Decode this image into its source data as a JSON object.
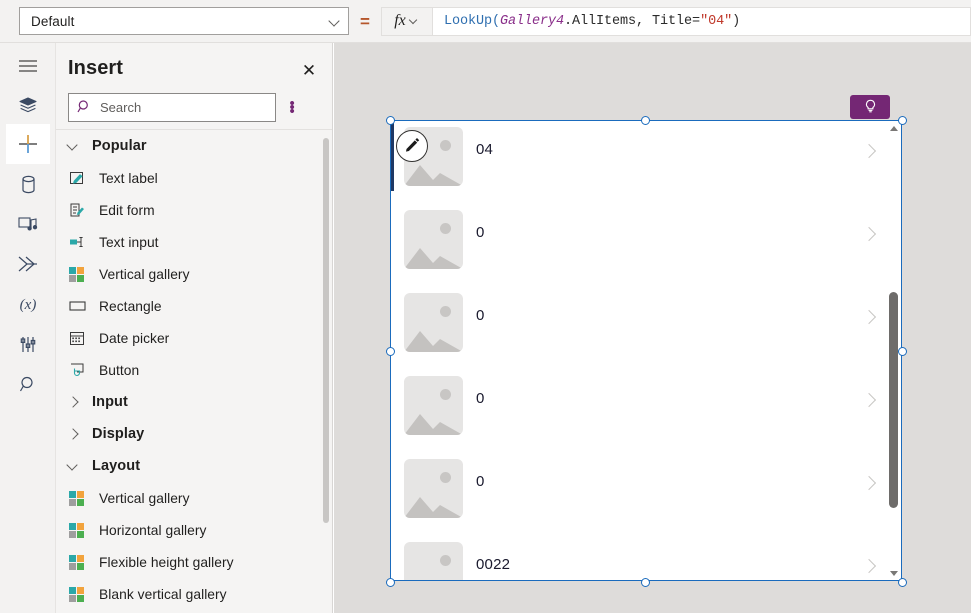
{
  "formula_bar": {
    "property_dropdown": {
      "value": "Default",
      "icon": "chevron-down-icon"
    },
    "equals": "=",
    "fx_label": "fx",
    "formula_tokens": [
      {
        "text": "LookUp(",
        "type": "function"
      },
      {
        "text": "Gallery4",
        "type": "control"
      },
      {
        "text": ".AllItems, Title=",
        "type": "plain"
      },
      {
        "text": "\"04\"",
        "type": "string"
      },
      {
        "text": ")",
        "type": "plain"
      }
    ],
    "formula_text": "LookUp(Gallery4.AllItems, Title=\"04\")"
  },
  "rail": {
    "items": [
      {
        "icon": "hamburger-menu-icon",
        "name": "menu",
        "selected": false
      },
      {
        "icon": "tree-view-icon",
        "name": "tree-view",
        "selected": false
      },
      {
        "icon": "plus-icon",
        "name": "insert",
        "selected": true
      },
      {
        "icon": "database-icon",
        "name": "data",
        "selected": false
      },
      {
        "icon": "media-icon",
        "name": "media",
        "selected": false
      },
      {
        "icon": "power-automate-icon",
        "name": "power-automate",
        "selected": false
      },
      {
        "icon": "variables-icon",
        "name": "variables",
        "selected": false
      },
      {
        "icon": "settings-sliders-icon",
        "name": "advanced",
        "selected": false
      },
      {
        "icon": "search-icon",
        "name": "search",
        "selected": false
      }
    ]
  },
  "insert_panel": {
    "title": "Insert",
    "close_icon": "close-icon",
    "search": {
      "placeholder": "Search",
      "icon": "search-icon",
      "value": ""
    },
    "more_icon": "more-vertical-icon",
    "groups": [
      {
        "label": "Popular",
        "expanded": true,
        "items": [
          {
            "label": "Text label",
            "icon": "text-label-icon"
          },
          {
            "label": "Edit form",
            "icon": "edit-form-icon"
          },
          {
            "label": "Text input",
            "icon": "text-input-icon"
          },
          {
            "label": "Vertical gallery",
            "icon": "gallery-icon"
          },
          {
            "label": "Rectangle",
            "icon": "rectangle-icon"
          },
          {
            "label": "Date picker",
            "icon": "calendar-icon"
          },
          {
            "label": "Button",
            "icon": "button-icon"
          }
        ]
      },
      {
        "label": "Input",
        "expanded": false,
        "items": []
      },
      {
        "label": "Display",
        "expanded": false,
        "items": []
      },
      {
        "label": "Layout",
        "expanded": true,
        "items": [
          {
            "label": "Vertical gallery",
            "icon": "gallery-icon"
          },
          {
            "label": "Horizontal gallery",
            "icon": "gallery-icon"
          },
          {
            "label": "Flexible height gallery",
            "icon": "gallery-icon"
          },
          {
            "label": "Blank vertical gallery",
            "icon": "gallery-icon"
          }
        ]
      }
    ]
  },
  "canvas": {
    "ideas_button": {
      "icon": "lightbulb-icon",
      "color": "#742774"
    },
    "gallery": {
      "name": "Gallery4",
      "selected": true,
      "edit_badge_icon": "pencil-icon",
      "rows": [
        {
          "label": "04",
          "selected": true,
          "image_icon": "image-placeholder-icon",
          "chevron": "chevron-right-icon"
        },
        {
          "label": "0",
          "selected": false,
          "image_icon": "image-placeholder-icon",
          "chevron": "chevron-right-icon"
        },
        {
          "label": "0",
          "selected": false,
          "image_icon": "image-placeholder-icon",
          "chevron": "chevron-right-icon"
        },
        {
          "label": "0",
          "selected": false,
          "image_icon": "image-placeholder-icon",
          "chevron": "chevron-right-icon"
        },
        {
          "label": "0",
          "selected": false,
          "image_icon": "image-placeholder-icon",
          "chevron": "chevron-right-icon"
        },
        {
          "label": "0022",
          "selected": false,
          "image_icon": "image-placeholder-icon",
          "chevron": "chevron-right-icon"
        }
      ],
      "scrollbar": {
        "up_icon": "triangle-up-icon",
        "down_icon": "triangle-down-icon"
      }
    }
  },
  "colors": {
    "brand_purple": "#742774",
    "selection_blue": "#1a6bbd",
    "selected_item_bar": "#1f3864",
    "canvas_bg": "#dedcda",
    "panel_bg": "#f5f4f3"
  }
}
